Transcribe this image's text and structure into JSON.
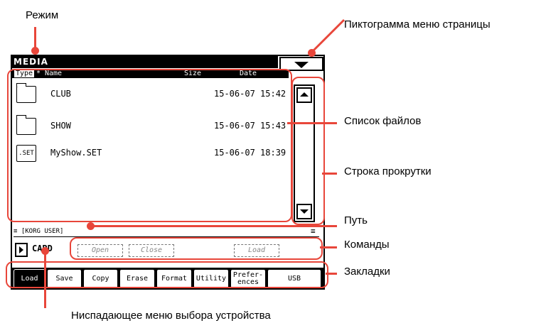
{
  "labels": {
    "mode": "Режим",
    "page_menu_icon": "Пиктограмма меню страницы",
    "file_list": "Список файлов",
    "scroll_bar": "Строка прокрутки",
    "path": "Путь",
    "commands": "Команды",
    "tabs": "Закладки",
    "device_menu": "Ниспадающее меню выбора устройства"
  },
  "screen": {
    "title": "MEDIA",
    "columns": {
      "type": "Type",
      "star": "*",
      "name": "Name",
      "size": "Size",
      "date": "Date"
    },
    "files": [
      {
        "icon": "folder-icon",
        "type_label": "",
        "name": "CLUB",
        "date": "15-06-07 15:42"
      },
      {
        "icon": "folder-icon",
        "type_label": "",
        "name": "SHOW",
        "date": "15-06-07 15:43"
      },
      {
        "icon": "set-file-icon",
        "type_label": ".SET",
        "name": "MyShow.SET",
        "date": "15-06-07 18:39"
      }
    ],
    "path": "≡ [KORG USER]",
    "path_end": "≡",
    "device": "CARD",
    "commands": {
      "open": "Open",
      "close": "Close",
      "load": "Load"
    },
    "tabs": [
      "Load",
      "Save",
      "Copy",
      "Erase",
      "Format",
      "Utility",
      "Prefer-\nences",
      "USB"
    ],
    "active_tab": "Load"
  },
  "colors": {
    "callout": "#e8463a",
    "lcd": "#000000"
  }
}
